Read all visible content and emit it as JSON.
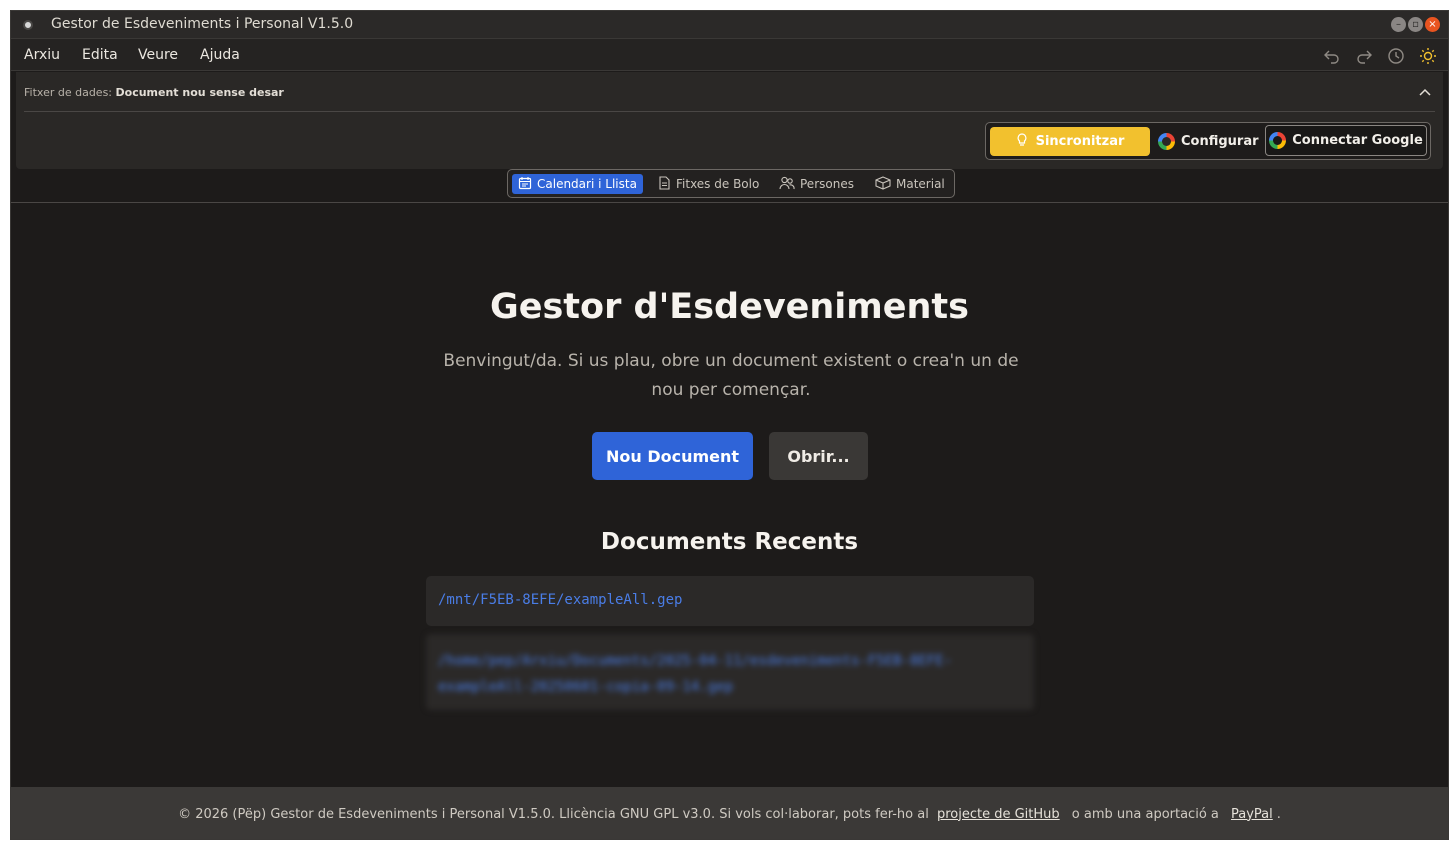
{
  "window": {
    "title": "Gestor de Esdeveniments i Personal V1.5.0"
  },
  "menu": {
    "items": [
      "Arxiu",
      "Edita",
      "Veure",
      "Ajuda"
    ]
  },
  "file_bar": {
    "label": "Fitxer de dades:",
    "value": "Document nou sense desar"
  },
  "sync": {
    "sync_label": "Sincronitzar",
    "config_label": "Configurar",
    "google_label": "Connectar Google"
  },
  "tabs": [
    {
      "label": "Calendari i Llista",
      "icon": "calendar-icon"
    },
    {
      "label": "Fitxes de Bolo",
      "icon": "document-icon"
    },
    {
      "label": "Persones",
      "icon": "people-icon"
    },
    {
      "label": "Material",
      "icon": "box-icon"
    }
  ],
  "main": {
    "title": "Gestor d'Esdeveniments",
    "subtitle": "Benvingut/da. Si us plau, obre un document existent o crea'n un de nou per començar.",
    "new_label": "Nou Document",
    "open_label": "Obrir...",
    "recent_title": "Documents Recents",
    "recent": [
      "/mnt/F5EB-8EFE/exampleAll.gep",
      "/home/pep/Arxiu/Documents/2025-04-11/esdeveniments-F5EB-8EFE-exampleAll-20250601-copia-09-14.gep"
    ]
  },
  "footer": {
    "text_before": "© 2026 (Pëp) Gestor de Esdeveniments i Personal V1.5.0. Llicència GNU GPL v3.0. Si vols col·laborar, pots fer-ho al",
    "github_link": "projecte de GitHub",
    "text_middle": "o amb una aportació a",
    "paypal_link": "PayPal",
    "text_after": "."
  },
  "colors": {
    "accent_blue": "#2f64d8",
    "sync_yellow": "#f2c12e",
    "background": "#1d1b1a"
  }
}
